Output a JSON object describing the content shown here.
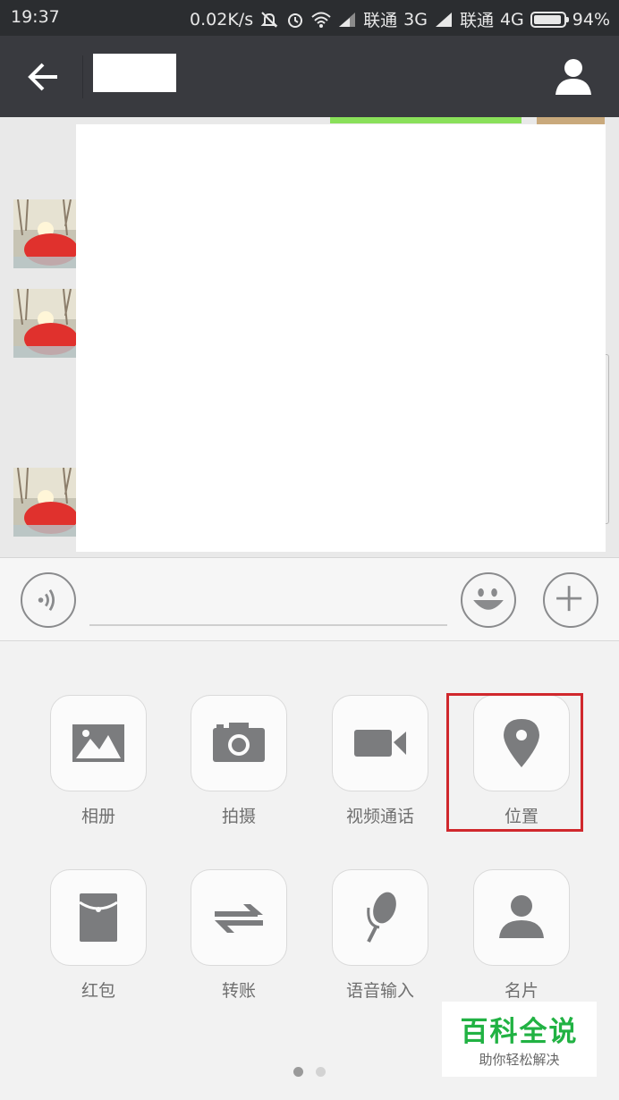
{
  "status_bar": {
    "time": "19:37",
    "speed": "0.02K/s",
    "carrier1": "联通",
    "net1": "3G",
    "carrier2": "联通",
    "net2": "4G",
    "battery_percent": "94%",
    "battery_level": 0.94
  },
  "input": {
    "placeholder": ""
  },
  "panel": {
    "items": [
      {
        "label": "相册",
        "icon": "album-icon"
      },
      {
        "label": "拍摄",
        "icon": "camera-icon"
      },
      {
        "label": "视频通话",
        "icon": "video-call-icon"
      },
      {
        "label": "位置",
        "icon": "location-icon"
      },
      {
        "label": "红包",
        "icon": "red-packet-icon"
      },
      {
        "label": "转账",
        "icon": "transfer-icon"
      },
      {
        "label": "语音输入",
        "icon": "microphone-icon"
      },
      {
        "label": "名片",
        "icon": "contact-card-icon"
      }
    ],
    "pages": 2,
    "current_page": 1,
    "highlighted": "位置"
  },
  "watermark": {
    "title": "百科全说",
    "subtitle": "助你轻松解决"
  },
  "colors": {
    "title_bar": "#393a3f",
    "status_bar": "#2b2d30",
    "highlight": "#d0282d",
    "bubble_green": "#8ae05a",
    "watermark_green": "#21b243"
  }
}
